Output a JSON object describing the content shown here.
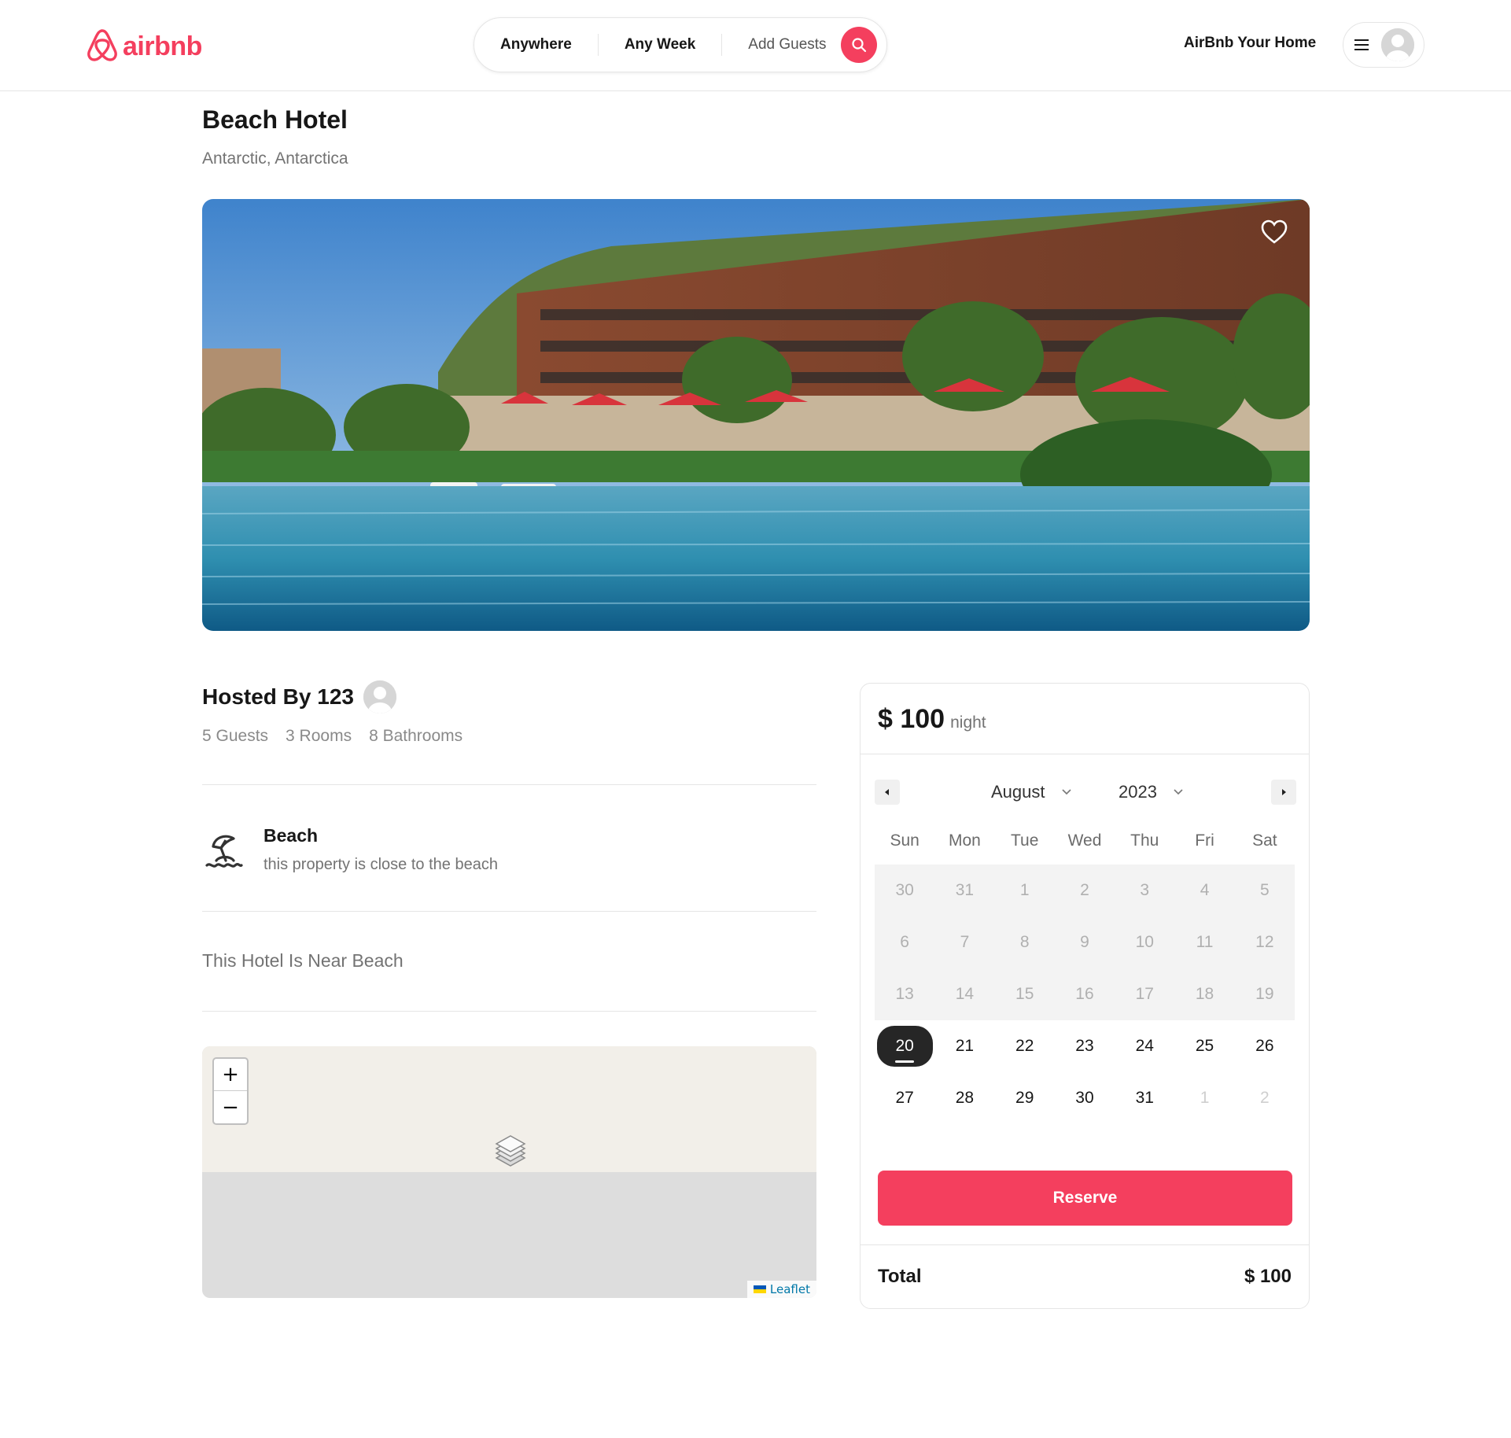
{
  "nav": {
    "logo_text": "airbnb",
    "brand_color": "#f43f5e",
    "search": {
      "where": "Anywhere",
      "when": "Any Week",
      "who": "Add Guests"
    },
    "host_link": "AirBnb Your Home",
    "icons": {
      "logo": "airbnb-logo-icon",
      "search": "search-icon",
      "menu": "hamburger-icon",
      "avatar": "user-avatar-icon"
    }
  },
  "listing": {
    "title": "Beach Hotel",
    "location": "Antarctic, Antarctica",
    "hero_icon": "heart-icon"
  },
  "host": {
    "label": "Hosted By 123",
    "guests": "5 Guests",
    "rooms": "3 Rooms",
    "bathrooms": "8 Bathrooms"
  },
  "feature": {
    "icon": "beach-umbrella-icon",
    "title": "Beach",
    "description": "this property is close to the beach"
  },
  "description": "This Hotel Is Near Beach",
  "map": {
    "zoom_in": "+",
    "zoom_out": "−",
    "attribution": "Leaflet"
  },
  "booking": {
    "price": "$ 100",
    "per": "night",
    "calendar": {
      "month": "August",
      "year": "2023",
      "weekdays": [
        "Sun",
        "Mon",
        "Tue",
        "Wed",
        "Thu",
        "Fri",
        "Sat"
      ],
      "weeks": [
        [
          "30",
          "31",
          "1",
          "2",
          "3",
          "4",
          "5"
        ],
        [
          "6",
          "7",
          "8",
          "9",
          "10",
          "11",
          "12"
        ],
        [
          "13",
          "14",
          "15",
          "16",
          "17",
          "18",
          "19"
        ],
        [
          "20",
          "21",
          "22",
          "23",
          "24",
          "25",
          "26"
        ],
        [
          "27",
          "28",
          "29",
          "30",
          "31",
          "1",
          "2"
        ]
      ],
      "selected": "20"
    },
    "reserve_label": "Reserve",
    "total_label": "Total",
    "total_value": "$ 100"
  }
}
